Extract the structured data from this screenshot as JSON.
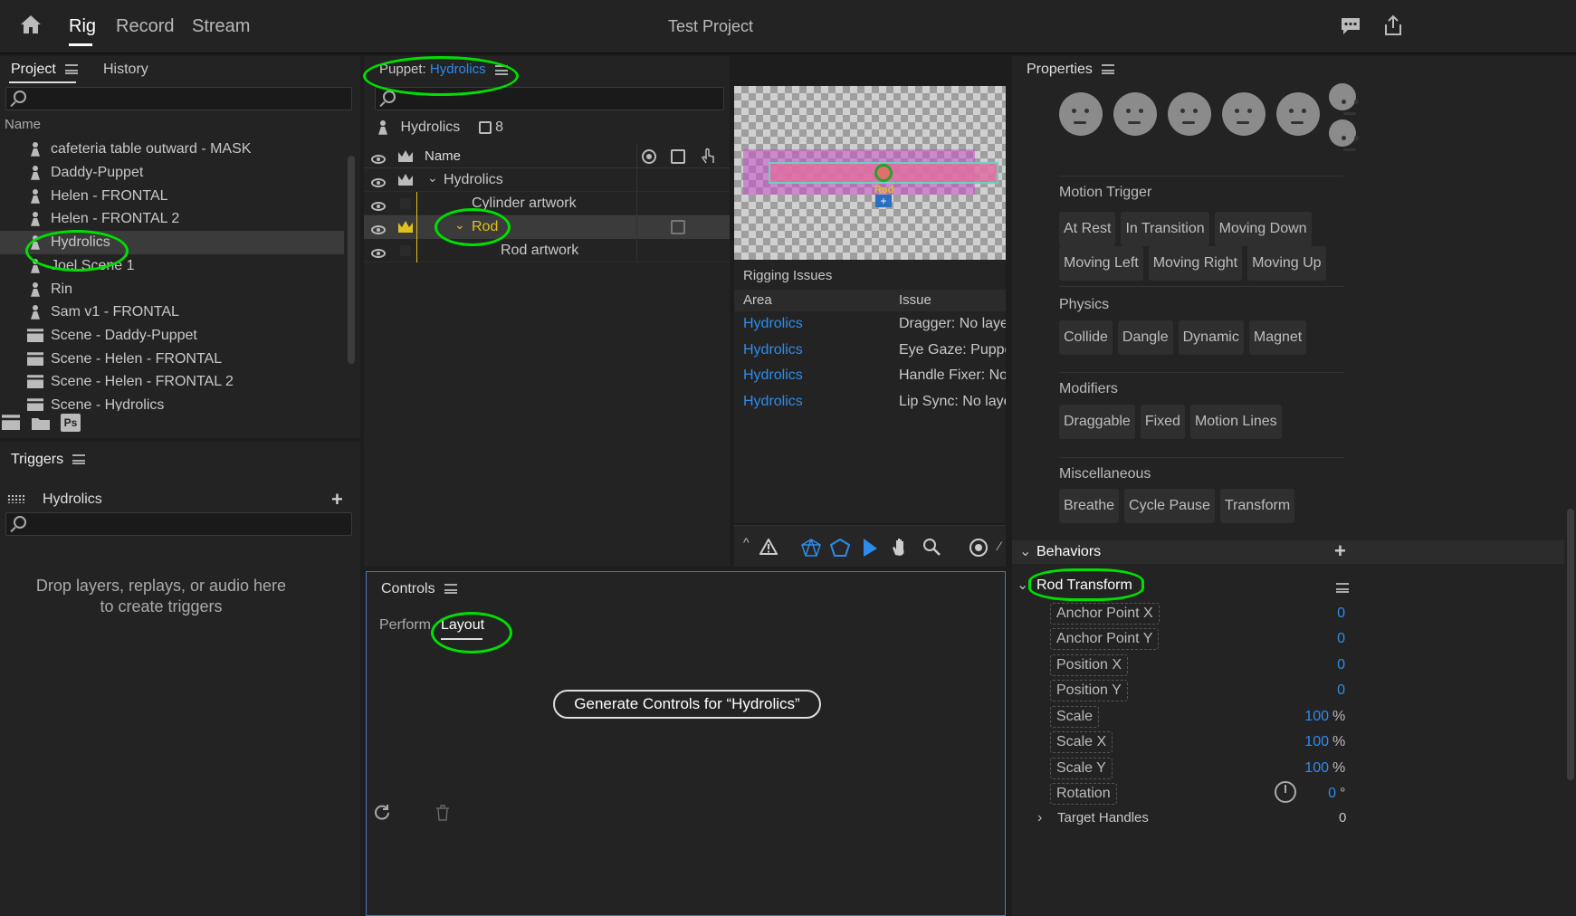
{
  "topbar": {
    "tabs": [
      "Rig",
      "Record",
      "Stream"
    ],
    "active_tab": "Rig",
    "project_title": "Test Project"
  },
  "project_panel": {
    "tabs": [
      "Project",
      "History"
    ],
    "column_name": "Name",
    "items": [
      {
        "label": "cafeteria table outward - MASK",
        "type": "puppet"
      },
      {
        "label": "Daddy-Puppet",
        "type": "puppet"
      },
      {
        "label": "Helen - FRONTAL",
        "type": "puppet"
      },
      {
        "label": "Helen - FRONTAL 2",
        "type": "puppet"
      },
      {
        "label": "Hydrolics",
        "type": "puppet",
        "selected": true
      },
      {
        "label": "Joel Scene 1",
        "type": "puppet"
      },
      {
        "label": "Rin",
        "type": "puppet"
      },
      {
        "label": "Sam v1 - FRONTAL",
        "type": "puppet"
      },
      {
        "label": "Scene - Daddy-Puppet",
        "type": "scene"
      },
      {
        "label": "Scene - Helen - FRONTAL",
        "type": "scene"
      },
      {
        "label": "Scene - Helen - FRONTAL 2",
        "type": "scene"
      },
      {
        "label": "Scene - Hydrolics",
        "type": "scene"
      }
    ],
    "ps_badge": "Ps"
  },
  "triggers_panel": {
    "title": "Triggers",
    "puppet_name": "Hydrolics",
    "empty_line1": "Drop layers, replays, or audio here",
    "empty_line2": "to create triggers"
  },
  "puppet_panel": {
    "title_prefix": "Puppet:",
    "title_name": "Hydrolics",
    "header_name": "Hydrolics",
    "handle_count": "8",
    "column_name": "Name",
    "layers": [
      "Hydrolics",
      "Cylinder artwork",
      "Rod",
      "Rod artwork"
    ],
    "canvas_label": "Rod"
  },
  "rigging_issues": {
    "title": "Rigging Issues",
    "columns": [
      "Area",
      "Issue"
    ],
    "rows": [
      {
        "area": "Hydrolics",
        "issue": "Dragger: No layers"
      },
      {
        "area": "Hydrolics",
        "issue": "Eye Gaze: Puppet"
      },
      {
        "area": "Hydrolics",
        "issue": "Handle Fixer: No l"
      },
      {
        "area": "Hydrolics",
        "issue": "Lip Sync: No layer"
      }
    ]
  },
  "controls_panel": {
    "title": "Controls",
    "tabs": [
      "Perform",
      "Layout"
    ],
    "active_tab": "Layout",
    "generate_button": "Generate Controls for “Hydrolics”"
  },
  "properties_panel": {
    "title": "Properties",
    "motion_trigger": {
      "title": "Motion Trigger",
      "tags": [
        "At Rest",
        "In Transition",
        "Moving Down",
        "Moving Left",
        "Moving Right",
        "Moving Up"
      ]
    },
    "physics": {
      "title": "Physics",
      "tags": [
        "Collide",
        "Dangle",
        "Dynamic",
        "Magnet"
      ]
    },
    "modifiers": {
      "title": "Modifiers",
      "tags": [
        "Draggable",
        "Fixed",
        "Motion Lines"
      ]
    },
    "miscellaneous": {
      "title": "Miscellaneous",
      "tags": [
        "Breathe",
        "Cycle Pause",
        "Transform"
      ]
    },
    "behaviors_title": "Behaviors",
    "behavior_name": "Rod Transform",
    "params": [
      {
        "label": "Anchor Point X",
        "value": "0",
        "unit": ""
      },
      {
        "label": "Anchor Point Y",
        "value": "0",
        "unit": ""
      },
      {
        "label": "Position X",
        "value": "0",
        "unit": ""
      },
      {
        "label": "Position Y",
        "value": "0",
        "unit": ""
      },
      {
        "label": "Scale",
        "value": "100",
        "unit": "%"
      },
      {
        "label": "Scale X",
        "value": "100",
        "unit": "%"
      },
      {
        "label": "Scale Y",
        "value": "100",
        "unit": "%"
      },
      {
        "label": "Rotation",
        "value": "0",
        "unit": "°"
      }
    ],
    "target_handles": {
      "label": "Target Handles",
      "value": "0"
    }
  },
  "colors": {
    "accent_blue": "#2d8ceb",
    "annotation_green": "#00e000",
    "crown_yellow": "#e0c020"
  }
}
